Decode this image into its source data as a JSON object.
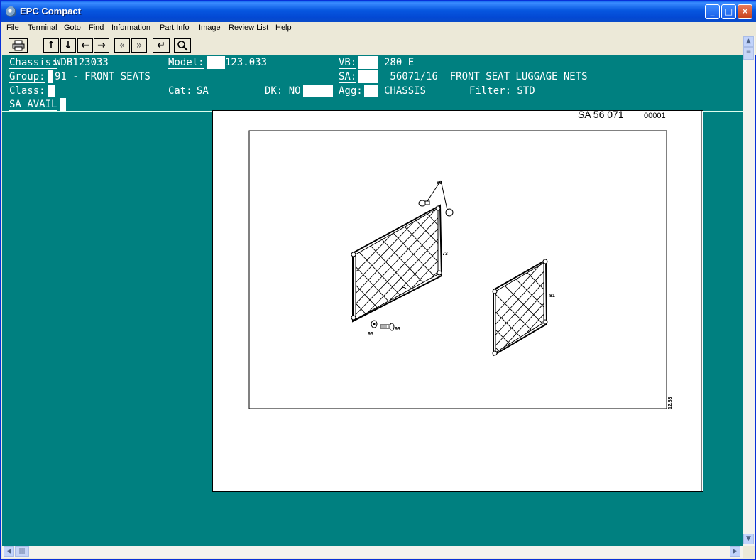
{
  "window": {
    "title": "EPC Compact"
  },
  "menu": [
    "File",
    "Terminal",
    "Goto",
    "Find",
    "Information",
    "Part Info",
    "Image",
    "Review List",
    "Help"
  ],
  "toolbar": {
    "print_icon": "printer-icon",
    "buttons": [
      "↑",
      "↓",
      "←",
      "→",
      "«",
      "»",
      "↵",
      "search-icon"
    ]
  },
  "header": {
    "chassis_label": "Chassis:",
    "chassis_value": "WDB123033",
    "model_label": "Model:",
    "model_value": "123.033",
    "vb_label": "VB:",
    "vb_value": "280 E",
    "group_label": "Group:",
    "group_value": "91 - FRONT SEATS",
    "sa_label": "SA:",
    "sa_value": " 56071/16  FRONT SEAT LUGGAGE NETS",
    "class_label": "Class:",
    "cat_label": "Cat:",
    "cat_value": "SA",
    "dk_label": "DK: NO",
    "agg_label": "Agg:",
    "agg_value": "CHASSIS",
    "filter_label": "Filter: STD",
    "sa_avail": "SA AVAIL"
  },
  "drawing": {
    "ref": "SA 56 071",
    "ref_num": "00001",
    "date": "12.83",
    "callouts": [
      "89",
      "73",
      "81",
      "95",
      "93"
    ]
  },
  "colors": {
    "teal": "#008080",
    "titlebar": "#0757e0"
  }
}
